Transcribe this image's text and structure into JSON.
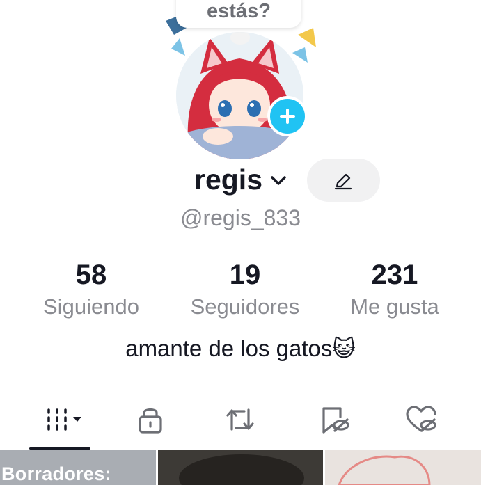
{
  "bubble": {
    "text": "estás?"
  },
  "profile": {
    "username": "regis",
    "handle": "@regis_833",
    "bio": "amante de los gatos",
    "bio_emoji": "😺"
  },
  "stats": [
    {
      "value": "58",
      "label": "Siguiendo"
    },
    {
      "value": "19",
      "label": "Seguidores"
    },
    {
      "value": "231",
      "label": "Me gusta"
    }
  ],
  "tabs": [
    {
      "icon": "grid-icon",
      "active": true
    },
    {
      "icon": "lock-icon",
      "active": false
    },
    {
      "icon": "repost-icon",
      "active": false
    },
    {
      "icon": "bookmark-hidden-icon",
      "active": false
    },
    {
      "icon": "heart-hidden-icon",
      "active": false
    }
  ],
  "grid": {
    "drafts_label": "Borradores:"
  },
  "colors": {
    "accent": "#20c3f3",
    "text": "#161823",
    "muted": "#8a8b91"
  }
}
